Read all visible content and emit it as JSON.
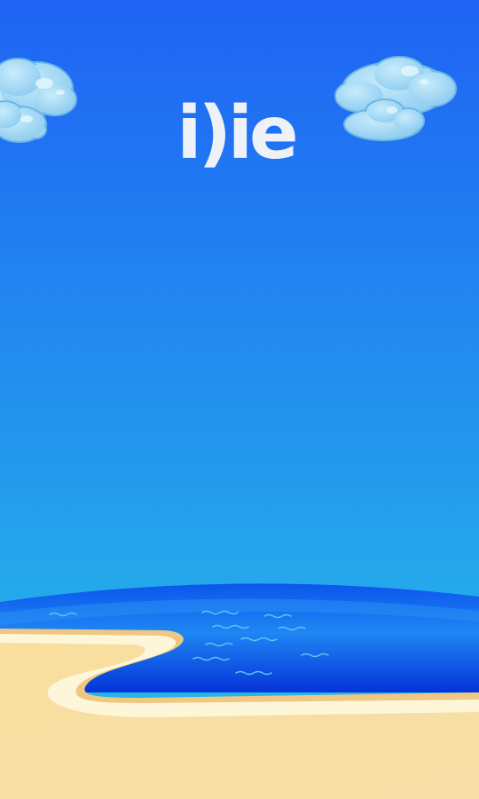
{
  "logo": {
    "text": "i)ie",
    "color": "#eef2f8"
  },
  "colors": {
    "sky_top": "#1f63f4",
    "sky_bottom": "#26c3e7",
    "ocean_light": "#2a8cf4",
    "ocean_deep": "#0533d8",
    "sand": "#f6dc9c",
    "sand_shade": "#efc783",
    "foam": "#fdf6d8",
    "cloud": "#9fd7f4",
    "cloud_shade": "#6bb7e6"
  }
}
